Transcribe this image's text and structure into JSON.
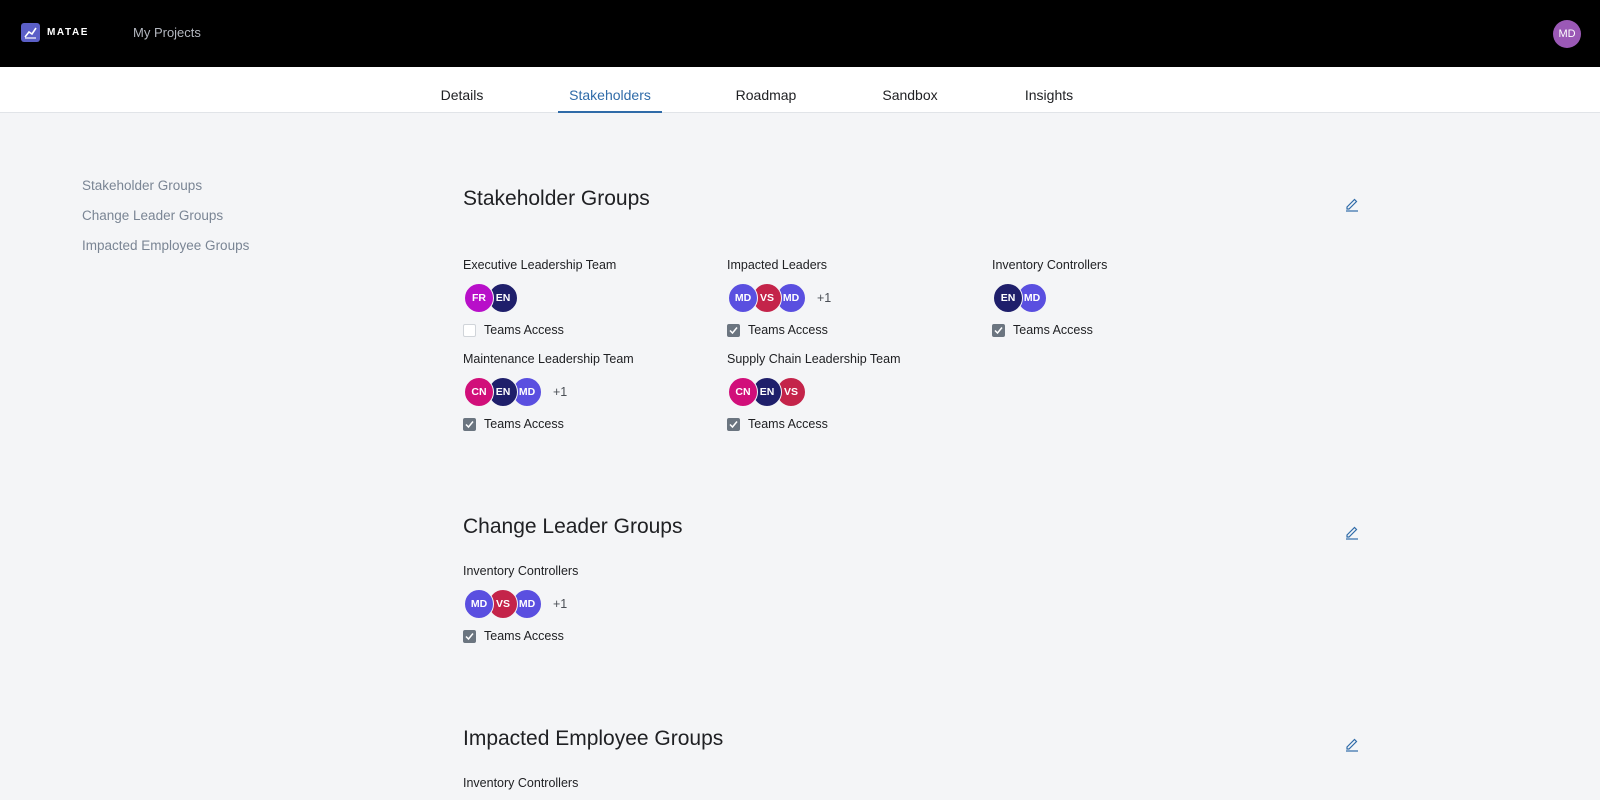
{
  "header": {
    "logo_text": "MATAE",
    "nav_link": "My Projects",
    "user_initials": "MD"
  },
  "tabs": [
    {
      "label": "Details",
      "active": false
    },
    {
      "label": "Stakeholders",
      "active": true
    },
    {
      "label": "Roadmap",
      "active": false
    },
    {
      "label": "Sandbox",
      "active": false
    },
    {
      "label": "Insights",
      "active": false
    }
  ],
  "side_nav": [
    "Stakeholder Groups",
    "Change Leader Groups",
    "Impacted Employee Groups"
  ],
  "colors": {
    "FR": "#b80fc9",
    "EN": "#1f1f6b",
    "MD": "#5a4fe0",
    "VS": "#c4244a",
    "CN": "#d10f7a"
  },
  "sections": [
    {
      "title": "Stakeholder Groups",
      "groups": [
        {
          "name": "Executive Leadership Team",
          "members": [
            "FR",
            "EN"
          ],
          "more": "",
          "teams_access": false,
          "access_label": "Teams Access"
        },
        {
          "name": "Impacted Leaders",
          "members": [
            "MD",
            "VS",
            "MD"
          ],
          "more": "+1",
          "teams_access": true,
          "access_label": "Teams Access"
        },
        {
          "name": "Inventory Controllers",
          "members": [
            "EN",
            "MD"
          ],
          "more": "",
          "teams_access": true,
          "access_label": "Teams Access"
        },
        {
          "name": "Maintenance Leadership Team",
          "members": [
            "CN",
            "EN",
            "MD"
          ],
          "more": "+1",
          "teams_access": true,
          "access_label": "Teams Access"
        },
        {
          "name": "Supply Chain Leadership Team",
          "members": [
            "CN",
            "EN",
            "VS"
          ],
          "more": "",
          "teams_access": true,
          "access_label": "Teams Access"
        }
      ]
    },
    {
      "title": "Change Leader Groups",
      "groups": [
        {
          "name": "Inventory Controllers",
          "members": [
            "MD",
            "VS",
            "MD"
          ],
          "more": "+1",
          "teams_access": true,
          "access_label": "Teams Access"
        }
      ]
    },
    {
      "title": "Impacted Employee Groups",
      "groups": [
        {
          "name": "Inventory Controllers",
          "members": [],
          "more": "",
          "teams_access": null,
          "access_label": ""
        }
      ]
    }
  ]
}
